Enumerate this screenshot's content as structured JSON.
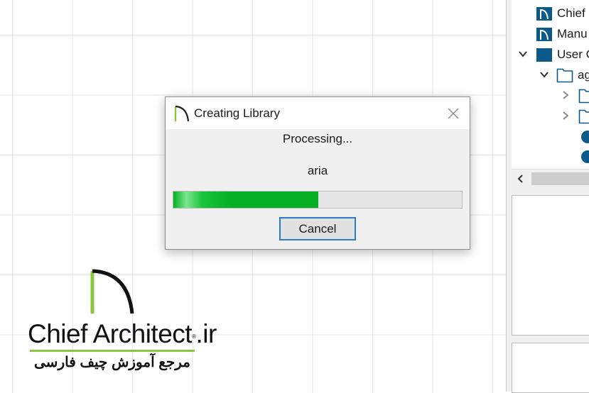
{
  "library_tree": {
    "items": [
      {
        "label": "Chief",
        "icon": "chief-folder-icon"
      },
      {
        "label": "Manu",
        "icon": "chief-folder-icon"
      },
      {
        "label": "User C",
        "icon": "folder-filled-icon"
      },
      {
        "label": "ag",
        "icon": "folder-outline-icon"
      }
    ]
  },
  "dialog": {
    "title": "Creating Library",
    "status": "Processing...",
    "item_name": "aria",
    "progress": 0.503,
    "cancel_label": "Cancel",
    "accent_color": "#06b025"
  },
  "logo": {
    "name": "Chief Architect",
    "suffix": ".ir",
    "reg_mark": "®",
    "tagline": "مرجع آموزش چیف فارسی",
    "green": "#8cc63f"
  }
}
